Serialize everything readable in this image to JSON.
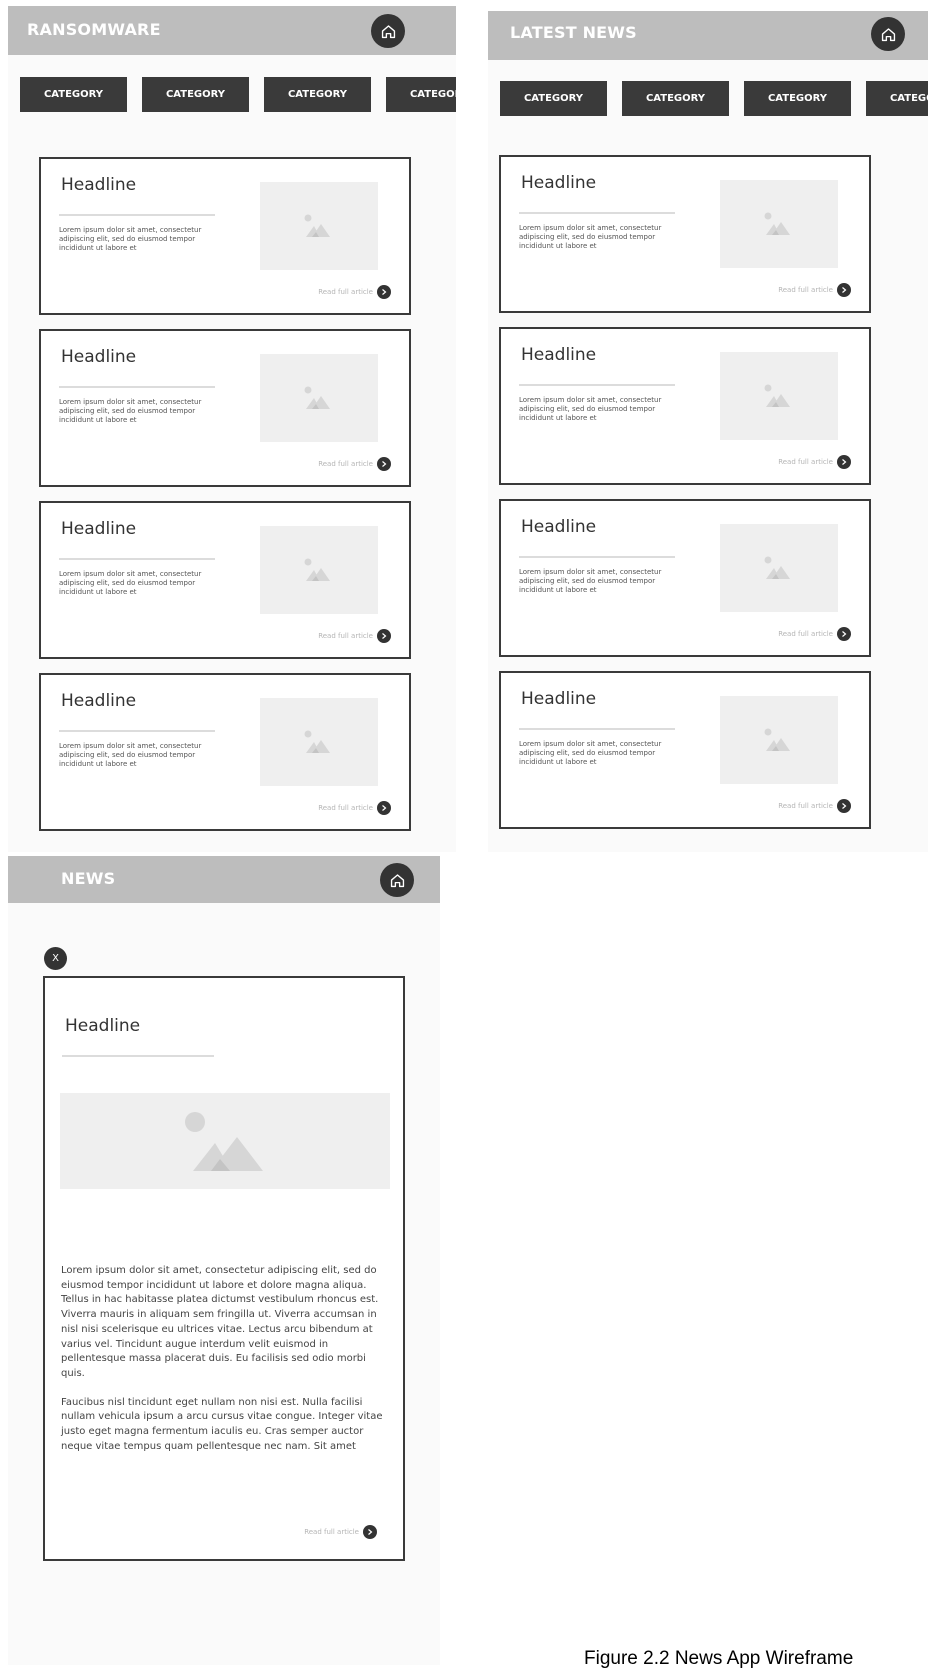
{
  "colors": {
    "app_bar": "#bdbdbd",
    "dark": "#333333",
    "tab_bg": "#3a3a3a",
    "screen_bg": "#fafafa",
    "placeholder": "#efefef"
  },
  "icons": {
    "home": "home-icon",
    "read_more": "arrow-right-icon",
    "image": "image-placeholder-icon"
  },
  "screens": {
    "ransomware": {
      "title": "RANSOMWARE",
      "tabs": [
        "CATEGORY",
        "CATEGORY",
        "CATEGORY",
        "CATEGORY"
      ],
      "cards": [
        {
          "headline": "Headline",
          "excerpt": "Lorem ipsum dolor sit amet, consectetur adipiscing elit, sed do eiusmod tempor incididunt ut labore et",
          "read_more": "Read full article"
        },
        {
          "headline": "Headline",
          "excerpt": "Lorem ipsum dolor sit amet, consectetur adipiscing elit, sed do eiusmod tempor incididunt ut labore et",
          "read_more": "Read full article"
        },
        {
          "headline": "Headline",
          "excerpt": "Lorem ipsum dolor sit amet, consectetur adipiscing elit, sed do eiusmod tempor incididunt ut labore et",
          "read_more": "Read full article"
        },
        {
          "headline": "Headline",
          "excerpt": "Lorem ipsum dolor sit amet, consectetur adipiscing elit, sed do eiusmod tempor incididunt ut labore et",
          "read_more": "Read full article"
        }
      ]
    },
    "latest": {
      "title": "LATEST NEWS",
      "tabs": [
        "CATEGORY",
        "CATEGORY",
        "CATEGORY",
        "CATEGORY"
      ],
      "cards": [
        {
          "headline": "Headline",
          "excerpt": "Lorem ipsum dolor sit amet, consectetur adipiscing elit, sed do eiusmod tempor incididunt ut labore et",
          "read_more": "Read full article"
        },
        {
          "headline": "Headline",
          "excerpt": "Lorem ipsum dolor sit amet, consectetur adipiscing elit, sed do eiusmod tempor incididunt ut labore et",
          "read_more": "Read full article"
        },
        {
          "headline": "Headline",
          "excerpt": "Lorem ipsum dolor sit amet, consectetur adipiscing elit, sed do eiusmod tempor incididunt ut labore et",
          "read_more": "Read full article"
        },
        {
          "headline": "Headline",
          "excerpt": "Lorem ipsum dolor sit amet, consectetur adipiscing elit, sed do eiusmod tempor incididunt ut labore et",
          "read_more": "Read full article"
        }
      ]
    },
    "news": {
      "title": "NEWS",
      "close_label": "X",
      "article": {
        "headline": "Headline",
        "paragraphs": [
          "Lorem ipsum dolor sit amet, consectetur adipiscing elit, sed do eiusmod tempor incididunt ut labore et dolore magna aliqua. Tellus in hac habitasse platea dictumst vestibulum rhoncus est. Viverra mauris in aliquam sem fringilla ut. Viverra accumsan in nisl nisi scelerisque eu ultrices vitae. Lectus arcu bibendum at varius vel. Tincidunt augue interdum velit euismod in pellentesque massa placerat duis. Eu facilisis sed odio morbi quis.",
          "Faucibus nisl tincidunt eget nullam non nisi est. Nulla facilisi nullam vehicula ipsum a arcu cursus vitae congue. Integer vitae justo eget magna fermentum iaculis eu. Cras semper auctor neque vitae tempus quam pellentesque nec nam. Sit amet"
        ],
        "read_more": "Read full article"
      }
    }
  },
  "caption": "Figure 2.2 News App Wireframe"
}
